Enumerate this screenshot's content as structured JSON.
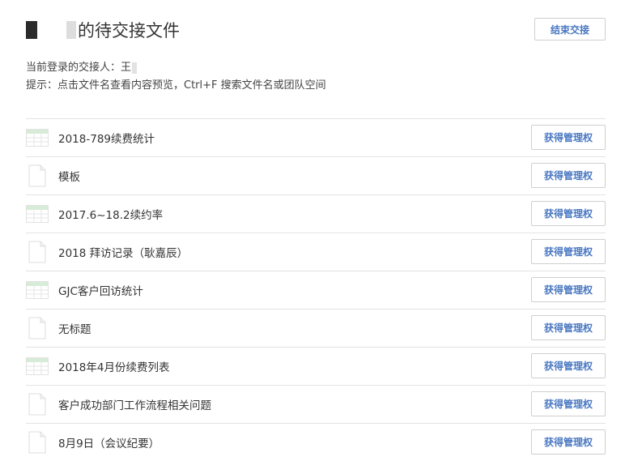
{
  "page": {
    "title_suffix": "的待交接文件",
    "end_button": "结束交接",
    "current_user_label": "当前登录的交接人：王",
    "hint": "提示：点击文件名查看内容预览，Ctrl+F 搜索文件名或团队空间"
  },
  "files": [
    {
      "name": "2018-789续费统计",
      "icon": "spreadsheet-icon",
      "action": "获得管理权"
    },
    {
      "name": "模板",
      "icon": "document-icon",
      "action": "获得管理权"
    },
    {
      "name": "2017.6~18.2续约率",
      "icon": "spreadsheet-icon",
      "action": "获得管理权"
    },
    {
      "name": "2018 拜访记录（耿嘉辰）",
      "icon": "document-icon",
      "action": "获得管理权"
    },
    {
      "name": "GJC客户回访统计",
      "icon": "spreadsheet-icon",
      "action": "获得管理权"
    },
    {
      "name": "无标题",
      "icon": "document-icon",
      "action": "获得管理权"
    },
    {
      "name": "2018年4月份续费列表",
      "icon": "spreadsheet-icon",
      "action": "获得管理权"
    },
    {
      "name": "客户成功部门工作流程相关问题",
      "icon": "document-icon",
      "action": "获得管理权"
    },
    {
      "name": "8月9日（会议纪要）",
      "icon": "document-icon",
      "action": "获得管理权"
    }
  ],
  "colors": {
    "accent": "#4a78c2",
    "sheet_header": "#d7ecd6",
    "divider": "#e3e3e3"
  }
}
